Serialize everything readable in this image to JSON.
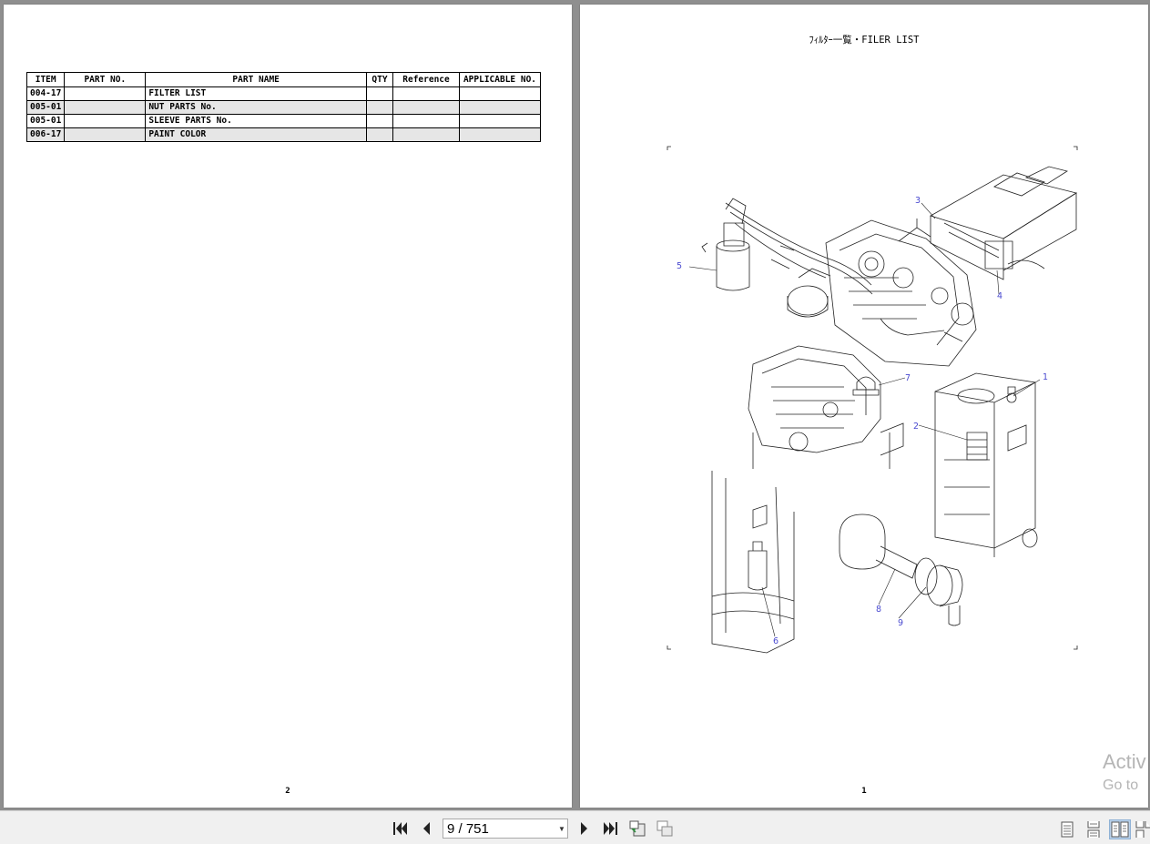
{
  "left_page": {
    "table": {
      "headers": [
        "ITEM",
        "PART NO.",
        "PART NAME",
        "QTY",
        "Reference",
        "APPLICABLE NO."
      ],
      "rows": [
        {
          "item": "004-17",
          "part_no": "",
          "part_name": "FILTER LIST",
          "qty": "",
          "reference": "",
          "applicable": ""
        },
        {
          "item": "005-01",
          "part_no": "",
          "part_name": "NUT PARTS No.",
          "qty": "",
          "reference": "",
          "applicable": ""
        },
        {
          "item": "005-01",
          "part_no": "",
          "part_name": "SLEEVE PARTS No.",
          "qty": "",
          "reference": "",
          "applicable": ""
        },
        {
          "item": "006-17",
          "part_no": "",
          "part_name": "PAINT COLOR",
          "qty": "",
          "reference": "",
          "applicable": ""
        }
      ]
    },
    "page_number": "2"
  },
  "right_page": {
    "title": "ﾌｨﾙﾀｰ一覧・FILER LIST",
    "callouts": [
      "1",
      "2",
      "3",
      "4",
      "5",
      "6",
      "7",
      "8",
      "9"
    ],
    "page_number": "1"
  },
  "watermark": {
    "line1": "Activ",
    "line2": "Go to"
  },
  "toolbar": {
    "page_indicator": "9 / 751",
    "icons": [
      "first-page-icon",
      "prev-page-icon",
      "next-page-icon",
      "last-page-icon",
      "rotate-icon",
      "view-toggle-icon",
      "single-page-icon",
      "continuous-icon",
      "facing-pages-icon",
      "facing-continuous-icon"
    ]
  },
  "colors": {
    "callout": "#4a4ad0",
    "background": "#8f8f8f",
    "toolbar": "#f0f0f0",
    "active_view": "#b9d1ea"
  }
}
